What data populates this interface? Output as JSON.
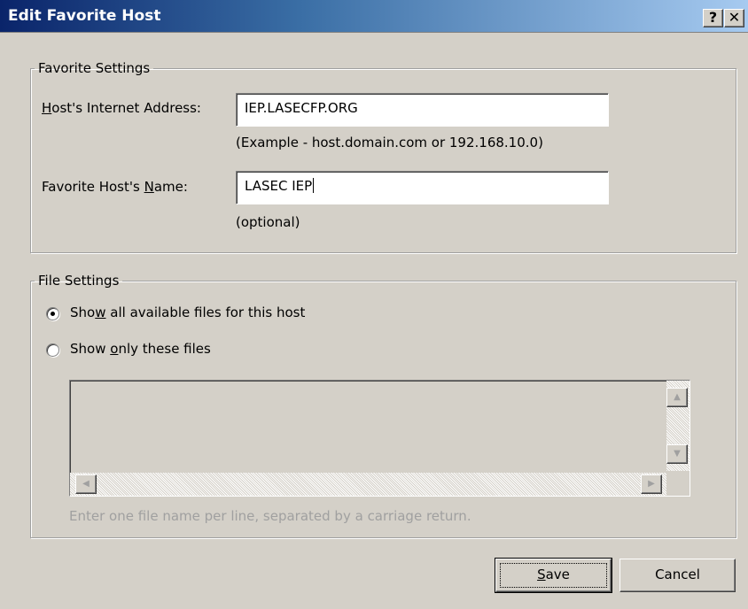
{
  "window": {
    "title": "Edit Favorite Host",
    "help_label": "?",
    "close_label": "✕"
  },
  "favorite_settings": {
    "legend": "Favorite Settings",
    "address_label_pre": "H",
    "address_label_rest": "ost's Internet Address:",
    "address_value": "IEP.LASECFP.ORG",
    "address_example": "(Example - host.domain.com or 192.168.10.0)",
    "name_label_pre": "Favorite Host's ",
    "name_label_u": "N",
    "name_label_rest": "ame:",
    "name_value": "LASEC IEP",
    "name_hint": "(optional)"
  },
  "file_settings": {
    "legend": "File Settings",
    "option_all_pre": "Sho",
    "option_all_u": "w",
    "option_all_rest": " all available files for this host",
    "option_all_checked": true,
    "option_only_pre": "Show ",
    "option_only_u": "o",
    "option_only_rest": "nly these files",
    "option_only_checked": false,
    "files_text": "",
    "instruction": "Enter one file name per line, separated by a carriage return."
  },
  "icons": {
    "scroll_up": "▲",
    "scroll_down": "▼",
    "scroll_left": "◀",
    "scroll_right": "▶"
  },
  "buttons": {
    "save_u": "S",
    "save_rest": "ave",
    "cancel": "Cancel"
  }
}
